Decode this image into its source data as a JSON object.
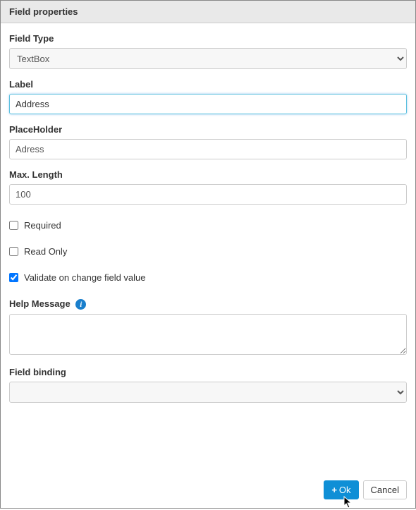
{
  "modal": {
    "title": "Field properties"
  },
  "form": {
    "fieldType": {
      "label": "Field Type",
      "value": "TextBox"
    },
    "label": {
      "label": "Label",
      "value": "Address"
    },
    "placeholder": {
      "label": "PlaceHolder",
      "value": "Adress"
    },
    "maxLength": {
      "label": "Max. Length",
      "value": "100"
    },
    "required": {
      "label": "Required",
      "checked": false
    },
    "readOnly": {
      "label": "Read Only",
      "checked": false
    },
    "validateOnChange": {
      "label": "Validate on change field value",
      "checked": true
    },
    "helpMessage": {
      "label": "Help Message",
      "value": ""
    },
    "fieldBinding": {
      "label": "Field binding",
      "value": ""
    }
  },
  "buttons": {
    "ok": "Ok",
    "cancel": "Cancel"
  },
  "icons": {
    "info": "i",
    "plus": "+"
  }
}
